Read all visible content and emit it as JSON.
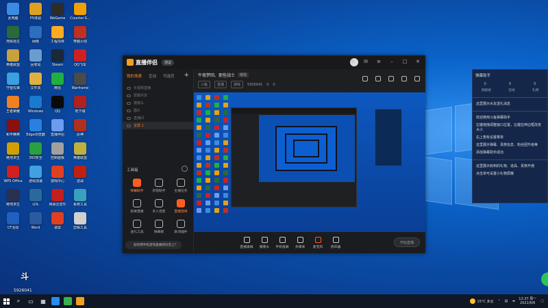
{
  "desktop": {
    "icons": [
      {
        "label": "此电脑",
        "color": "#3b8be0"
      },
      {
        "label": "PS体验",
        "color": "#e0a020"
      },
      {
        "label": "WeGame",
        "color": "#2c2c2c"
      },
      {
        "label": "Counter-S...",
        "color": "#f0a000"
      },
      {
        "label": "地铁逃生",
        "color": "#2a6a3a"
      },
      {
        "label": "网络",
        "color": "#2c6ec0"
      },
      {
        "label": "工程项目",
        "color": "#ffaa20"
      },
      {
        "label": "穿越火线",
        "color": "#c03020"
      },
      {
        "label": "英雄联盟",
        "color": "#c8a040"
      },
      {
        "label": "回收站",
        "color": "#6a9cd0"
      },
      {
        "label": "Steam",
        "color": "#1b2838"
      },
      {
        "label": "QQ飞车",
        "color": "#d02020"
      },
      {
        "label": "守望先锋",
        "color": "#3aa0e0"
      },
      {
        "label": "文件夹",
        "color": "#e0b040"
      },
      {
        "label": "微信",
        "color": "#20b040"
      },
      {
        "label": "Warframe",
        "color": "#4a4a4a"
      },
      {
        "label": "王者荣耀",
        "color": "#f08020"
      },
      {
        "label": "Windows",
        "color": "#1a7ad0"
      },
      {
        "label": "QQ",
        "color": "#0a0a0a"
      },
      {
        "label": "地下城",
        "color": "#b02020"
      },
      {
        "label": "和平精英",
        "color": "#8a1010"
      },
      {
        "label": "Edge浏览器",
        "color": "#2a80e0"
      },
      {
        "label": "直播伴侣",
        "color": "#6a9cf0"
      },
      {
        "label": "原神",
        "color": "#b03020"
      },
      {
        "label": "绝地求生",
        "color": "#d0a000"
      },
      {
        "label": "360安全",
        "color": "#2aa040"
      },
      {
        "label": "控制面板",
        "color": "#a0a0a0"
      },
      {
        "label": "英雄联盟",
        "color": "#c0b040"
      },
      {
        "label": "WPS Office",
        "color": "#d02020"
      },
      {
        "label": "游戏加速",
        "color": "#40a0e0"
      },
      {
        "label": "游戏中心",
        "color": "#e04020"
      },
      {
        "label": "逆战",
        "color": "#c02010"
      },
      {
        "label": "绝地求生",
        "color": "#2a3050"
      },
      {
        "label": "LOL",
        "color": "#2a6a9a"
      },
      {
        "label": "网易云音乐",
        "color": "#c02020"
      },
      {
        "label": "系统工具",
        "color": "#3aa0c0"
      },
      {
        "label": "CF活动",
        "color": "#2060c0"
      },
      {
        "label": "Word",
        "color": "#2a5aa0"
      },
      {
        "label": "录屏",
        "color": "#e04020"
      },
      {
        "label": "剪辑工具",
        "color": "#d0d0d0"
      },
      {
        "label": "CSGO",
        "color": "#404040"
      }
    ]
  },
  "app": {
    "logo_text": "直播伴侣",
    "version": "测试",
    "sidebar": {
      "tabs": [
        "我的场景",
        "互动",
        "可选页"
      ],
      "scenes": [
        "长视频直播",
        "屏幕共享",
        "摄像头",
        "图片",
        "直播间"
      ],
      "selected_scene": "全屏 1",
      "tools_title": "工具箱",
      "tools": [
        {
          "label": "弹幕助手",
          "hot": true
        },
        {
          "label": "房管助手",
          "hot": false
        },
        {
          "label": "主播任务",
          "hot": false
        },
        {
          "label": "投屏直播",
          "hot": false
        },
        {
          "label": "多人连麦",
          "hot": false
        },
        {
          "label": "直播连线",
          "hot": true
        },
        {
          "label": "送礼工具",
          "hot": false
        },
        {
          "label": "弹幕姬",
          "hot": false
        },
        {
          "label": "歌词插件",
          "hot": false
        }
      ],
      "notice": "如何把手机游戏直播到抖音上？"
    },
    "content": {
      "room_title": "午夜梦回、那些战士",
      "edit_tag": "修改",
      "meta_tags": [
        "斗鱼",
        "直播",
        "游戏"
      ],
      "room_id": "5926041",
      "likes": "0",
      "viewers": "0"
    },
    "controls": [
      {
        "label": "直播录屏"
      },
      {
        "label": "摄像头"
      },
      {
        "label": "手机投屏"
      },
      {
        "label": "多媒体"
      },
      {
        "label": "麦克风"
      },
      {
        "label": "扬声器"
      }
    ],
    "start_button": "开始直播"
  },
  "helper_panel": {
    "title": "弹幕助手",
    "stats": [
      "0",
      "0",
      "0"
    ],
    "stat_labels": [
      "贡献榜",
      "在线",
      "礼物"
    ],
    "line1": "这里展示水友送礼消息",
    "welcome": [
      "欢迎使用斗鱼弹幕助手",
      "左键拖拽调整窗口位置，左键拉伸边框改变大小",
      "右上角有设置菜单",
      "这里展示弹幕、贵族信息、粉丝团升级等",
      "添加弹幕助手成功"
    ],
    "line_bottom": [
      "这里展示收到的礼物、道具、贵族开通",
      "点击单可设置小礼物屏蔽"
    ]
  },
  "overlay_badge": {
    "big": "斗",
    "room": "5926041"
  },
  "taskbar": {
    "weather": "15°C 多云",
    "time": "12:37 周一",
    "date": "2021/6/6"
  }
}
